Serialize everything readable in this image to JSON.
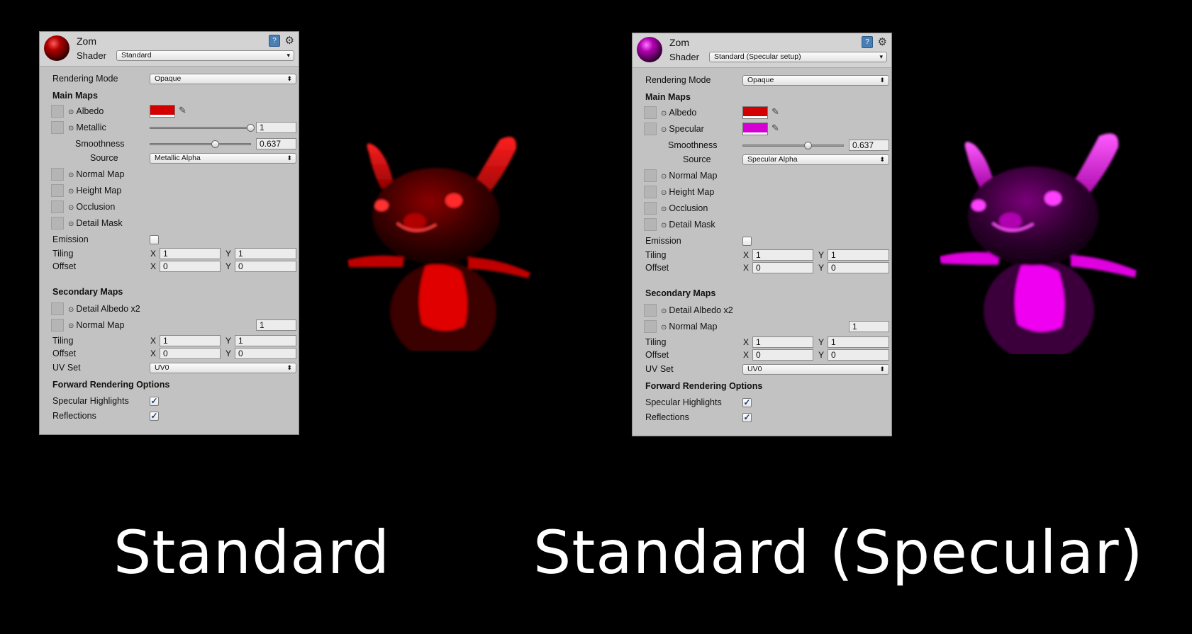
{
  "captions": {
    "left": "Standard",
    "right": "Standard (Specular)"
  },
  "colors": {
    "red": "#d40000",
    "magenta": "#d400d4",
    "panel_bg": "#c2c2c2"
  },
  "panels": [
    {
      "material_name": "Zom",
      "shader_label": "Shader",
      "shader_value": "Standard",
      "rendering_mode_label": "Rendering Mode",
      "rendering_mode_value": "Opaque",
      "main_maps": "Main Maps",
      "albedo": "Albedo",
      "second_map": "Metallic",
      "second_value": "1",
      "smoothness_label": "Smoothness",
      "smoothness_value": "0.637",
      "source_label": "Source",
      "source_value": "Metallic Alpha",
      "normal_map": "Normal Map",
      "height_map": "Height Map",
      "occlusion": "Occlusion",
      "detail_mask": "Detail Mask",
      "emission": "Emission",
      "tiling": "Tiling",
      "offset": "Offset",
      "x": "X",
      "y": "Y",
      "tiling_x": "1",
      "tiling_y": "1",
      "offset_x": "0",
      "offset_y": "0",
      "secondary_maps": "Secondary Maps",
      "detail_albedo": "Detail Albedo x2",
      "sec_normal_map": "Normal Map",
      "sec_normal_value": "1",
      "sec_tiling_x": "1",
      "sec_tiling_y": "1",
      "sec_offset_x": "0",
      "sec_offset_y": "0",
      "uv_set_label": "UV Set",
      "uv_set_value": "UV0",
      "forward_options": "Forward Rendering Options",
      "specular_highlights": "Specular Highlights",
      "reflections": "Reflections",
      "metallic_level": 1.0,
      "smoothness_level": 0.637
    },
    {
      "material_name": "Zom",
      "shader_label": "Shader",
      "shader_value": "Standard (Specular setup)",
      "rendering_mode_label": "Rendering Mode",
      "rendering_mode_value": "Opaque",
      "main_maps": "Main Maps",
      "albedo": "Albedo",
      "second_map": "Specular",
      "smoothness_label": "Smoothness",
      "smoothness_value": "0.637",
      "source_label": "Source",
      "source_value": "Specular Alpha",
      "normal_map": "Normal Map",
      "height_map": "Height Map",
      "occlusion": "Occlusion",
      "detail_mask": "Detail Mask",
      "emission": "Emission",
      "tiling": "Tiling",
      "offset": "Offset",
      "x": "X",
      "y": "Y",
      "tiling_x": "1",
      "tiling_y": "1",
      "offset_x": "0",
      "offset_y": "0",
      "secondary_maps": "Secondary Maps",
      "detail_albedo": "Detail Albedo x2",
      "sec_normal_map": "Normal Map",
      "sec_normal_value": "1",
      "sec_tiling_x": "1",
      "sec_tiling_y": "1",
      "sec_offset_x": "0",
      "sec_offset_y": "0",
      "uv_set_label": "UV Set",
      "uv_set_value": "UV0",
      "forward_options": "Forward Rendering Options",
      "specular_highlights": "Specular Highlights",
      "reflections": "Reflections",
      "smoothness_level": 0.637
    }
  ]
}
